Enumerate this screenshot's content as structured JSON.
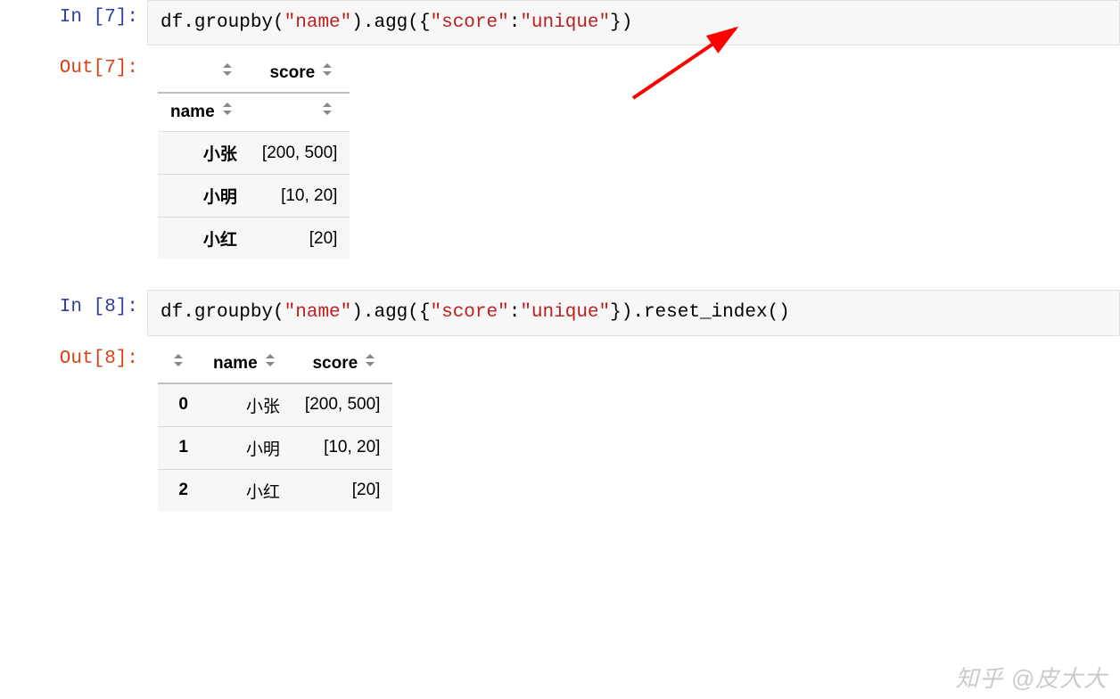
{
  "cells": {
    "in7": {
      "prompt": "In [7]:",
      "code_parts": {
        "p1": "df",
        "p2": ".groupby(",
        "s1": "\"name\"",
        "p3": ").agg({",
        "s2": "\"score\"",
        "p4": ":",
        "s3": "\"unique\"",
        "p5": "})"
      }
    },
    "out7": {
      "prompt": "Out[7]:",
      "table": {
        "col_header": "score",
        "index_name": "name",
        "rows": [
          {
            "name": "小张",
            "score": "[200, 500]"
          },
          {
            "name": "小明",
            "score": "[10, 20]"
          },
          {
            "name": "小红",
            "score": "[20]"
          }
        ]
      }
    },
    "in8": {
      "prompt": "In [8]:",
      "code_parts": {
        "p1": "df",
        "p2": ".groupby(",
        "s1": "\"name\"",
        "p3": ").agg({",
        "s2": "\"score\"",
        "p4": ":",
        "s3": "\"unique\"",
        "p5": "}).reset_index()"
      }
    },
    "out8": {
      "prompt": "Out[8]:",
      "table": {
        "columns": [
          "name",
          "score"
        ],
        "rows": [
          {
            "idx": "0",
            "name": "小张",
            "score": "[200, 500]"
          },
          {
            "idx": "1",
            "name": "小明",
            "score": "[10, 20]"
          },
          {
            "idx": "2",
            "name": "小红",
            "score": "[20]"
          }
        ]
      }
    }
  },
  "watermark": "知乎 @皮大大",
  "annotation": {
    "arrow_color": "#ff0000"
  }
}
